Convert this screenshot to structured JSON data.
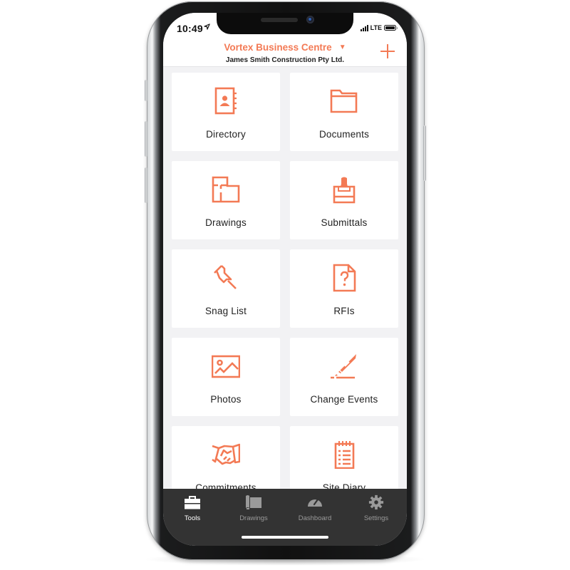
{
  "status_bar": {
    "time": "10:49",
    "location_icon": "location-arrow-icon",
    "network": "LTE",
    "signal_icon": "signal-bars-icon",
    "battery_icon": "battery-icon"
  },
  "header": {
    "project_title": "Vortex Business Centre",
    "dropdown_icon": "triangle-down-icon",
    "company_name": "James Smith Construction Pty Ltd.",
    "add_icon": "plus-icon"
  },
  "tools": [
    {
      "label": "Directory",
      "icon": "address-book-icon"
    },
    {
      "label": "Documents",
      "icon": "folder-icon"
    },
    {
      "label": "Drawings",
      "icon": "floor-plan-icon"
    },
    {
      "label": "Submittals",
      "icon": "stamp-icon"
    },
    {
      "label": "Snag List",
      "icon": "pushpin-icon"
    },
    {
      "label": "RFIs",
      "icon": "question-document-icon"
    },
    {
      "label": "Photos",
      "icon": "image-icon"
    },
    {
      "label": "Change Events",
      "icon": "pencil-icon"
    },
    {
      "label": "Commitments",
      "icon": "handshake-icon"
    },
    {
      "label": "Site Diary",
      "icon": "notepad-icon"
    }
  ],
  "tabbar": {
    "active": "Tools",
    "tabs": [
      {
        "label": "Tools",
        "icon": "toolbox-icon"
      },
      {
        "label": "Drawings",
        "icon": "blueprint-icon"
      },
      {
        "label": "Dashboard",
        "icon": "gauge-icon"
      },
      {
        "label": "Settings",
        "icon": "gear-icon"
      }
    ]
  },
  "colors": {
    "accent": "#f37a55",
    "tabbar_bg": "#333333",
    "screen_bg": "#f2f2f4",
    "tab_active": "#ffffff",
    "tab_inactive": "#9a9a9a"
  }
}
